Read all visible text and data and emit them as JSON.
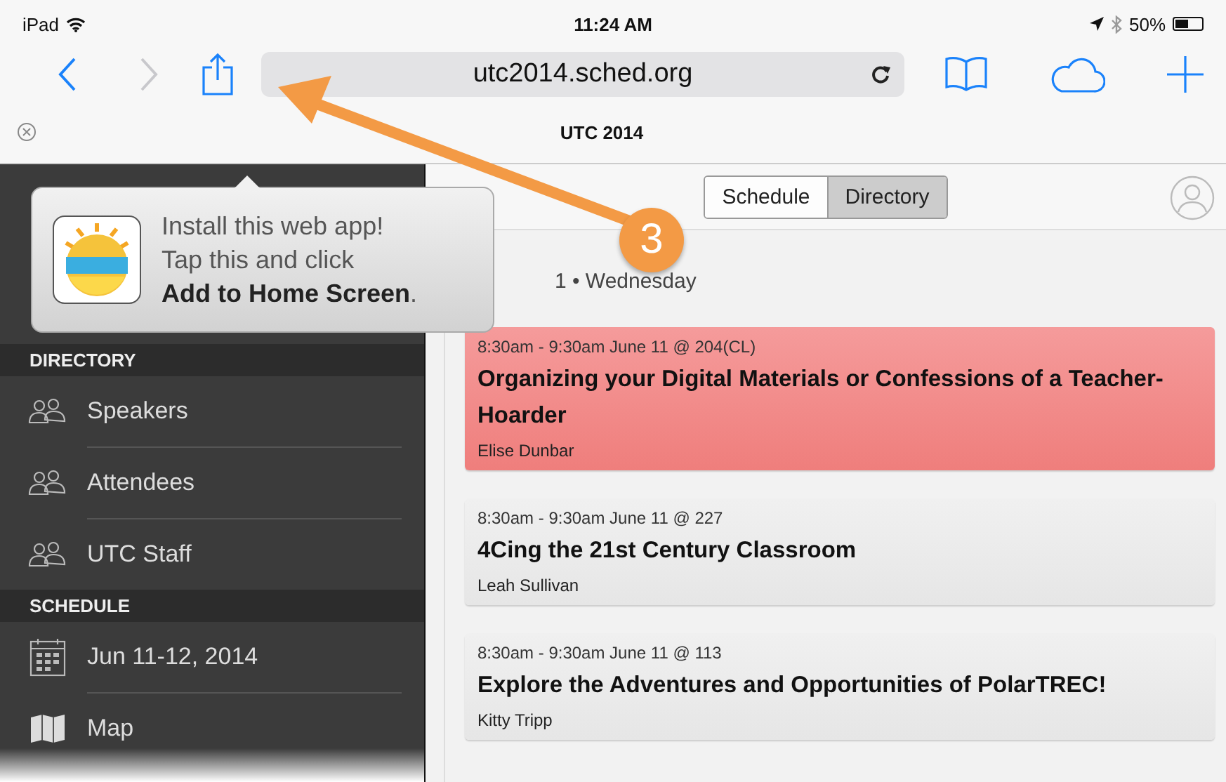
{
  "status_bar": {
    "device": "iPad",
    "time": "11:24 AM",
    "battery": "50%",
    "level": 0.5
  },
  "browser": {
    "nav": [
      {
        "kind": "back",
        "disabled": false
      },
      {
        "kind": "forward",
        "disabled": true
      }
    ],
    "url": "utc2014.sched.org",
    "tab_title": "UTC 2014"
  },
  "install_popup": {
    "message": "Install this web app!\nTap this and click\n**Add to Home Screen**."
  },
  "annotation": {
    "number": "3"
  },
  "sidebar": {
    "sections": [
      {
        "title": "DIRECTORY",
        "items": [
          {
            "label": "Speakers",
            "kind": "people"
          },
          {
            "label": "Attendees",
            "kind": "people"
          },
          {
            "label": "UTC Staff",
            "kind": "people"
          }
        ]
      },
      {
        "title": "SCHEDULE",
        "items": [
          {
            "label": "Jun 11-12, 2014",
            "kind": "calendar"
          },
          {
            "label": "Map",
            "kind": "map"
          }
        ]
      }
    ]
  },
  "view_tabs": [
    {
      "label": "Schedule",
      "selected": true
    },
    {
      "label": "Directory",
      "selected": false
    }
  ],
  "day_heading": "1 • Wednesday",
  "sessions": [
    {
      "when": "8:30am - 9:30am June 11 @ 204(CL)",
      "title": "Organizing your Digital Materials or Confessions of a Teacher-Hoarder",
      "speaker": "Elise Dunbar",
      "highlighted": true
    },
    {
      "when": "8:30am - 9:30am June 11 @ 227",
      "title": "4Cing the 21st Century Classroom",
      "speaker": "Leah Sullivan",
      "highlighted": false
    },
    {
      "when": "8:30am - 9:30am June 11 @ 113",
      "title": "Explore the Adventures and Opportunities of PolarTREC!",
      "speaker": "Kitty Tripp",
      "highlighted": false
    }
  ]
}
